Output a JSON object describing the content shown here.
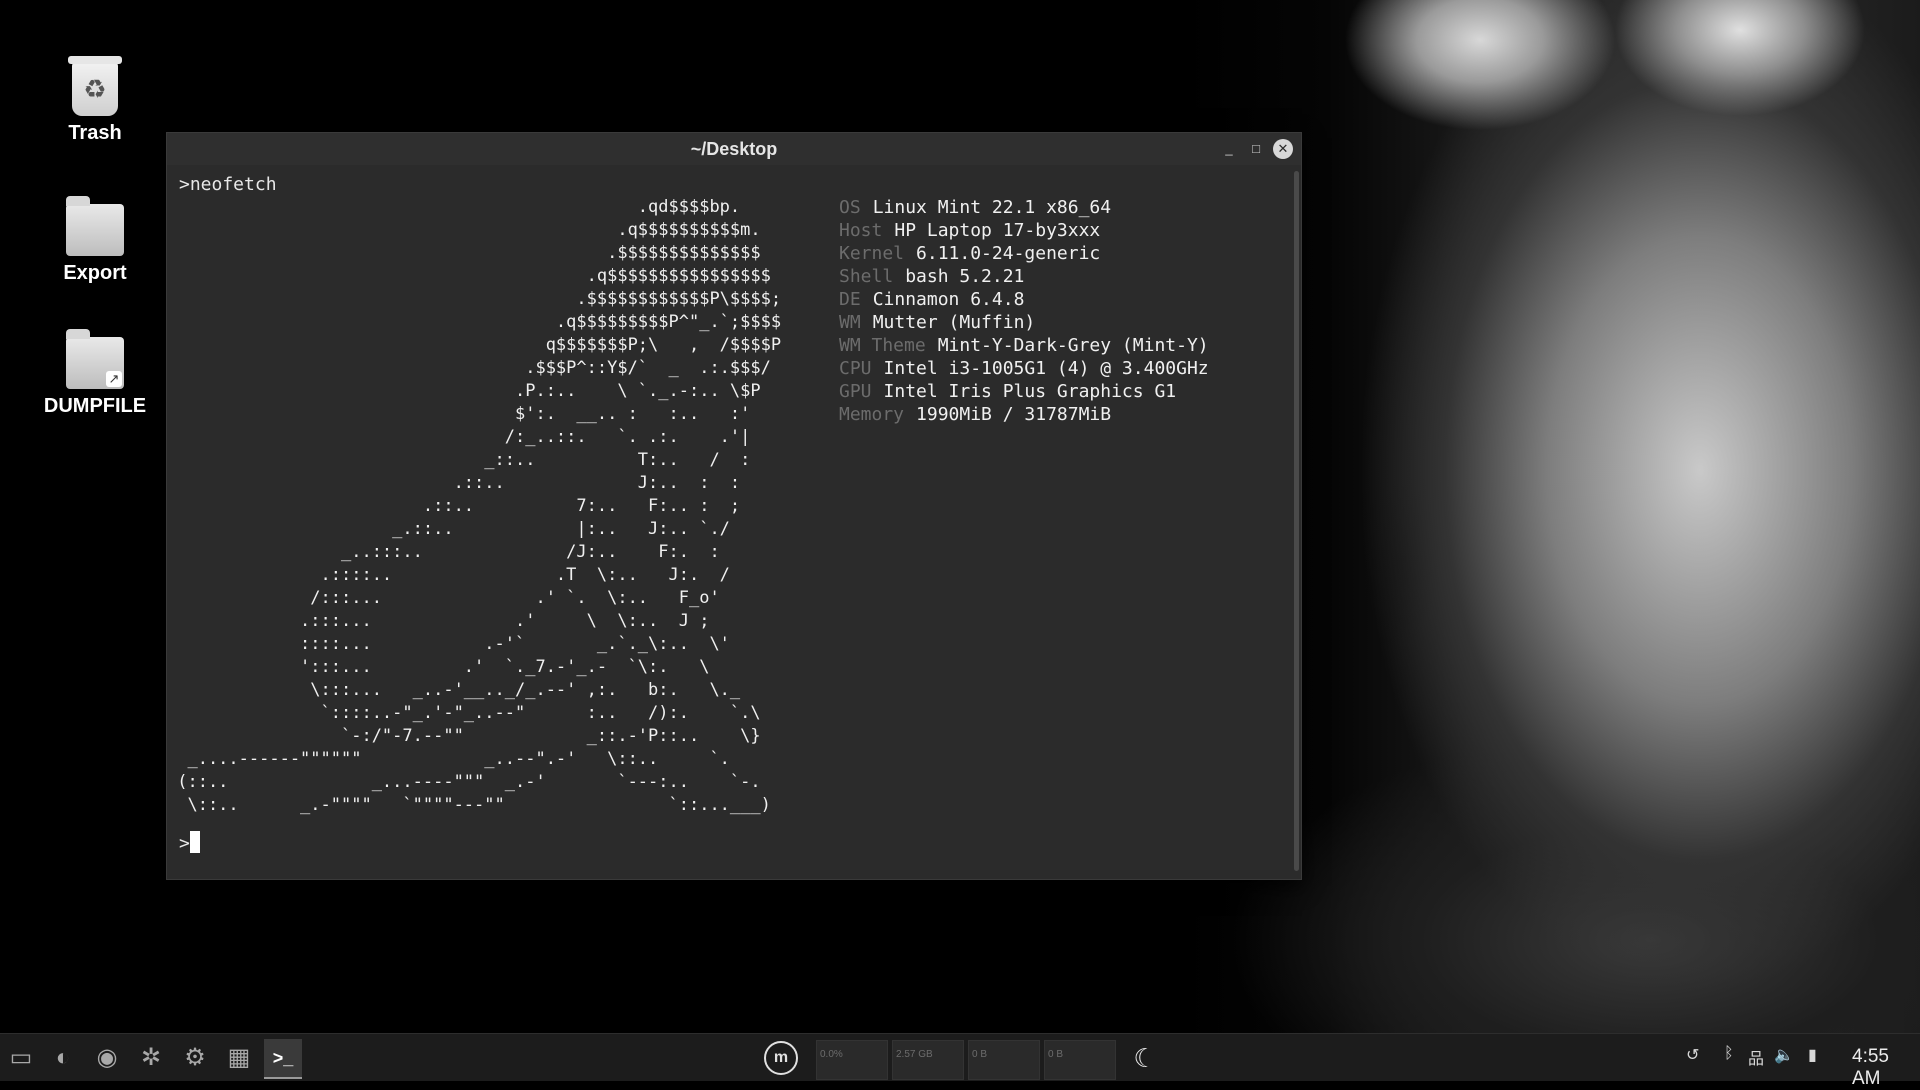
{
  "desktop": {
    "icons": [
      {
        "label": "Trash",
        "icon": "trash-icon"
      },
      {
        "label": "Export",
        "icon": "folder-icon"
      },
      {
        "label": "DUMPFILE",
        "icon": "folder-link-icon"
      }
    ]
  },
  "terminal": {
    "title": "~/Desktop",
    "controls": {
      "minimize": "_",
      "maximize": "□",
      "close": "✕"
    },
    "command": ">neofetch",
    "ascii_art": "                                              .qd$$$$bp.\n                                            .q$$$$$$$$$$m.\n                                           .$$$$$$$$$$$$$$\n                                         .q$$$$$$$$$$$$$$$$\n                                        .$$$$$$$$$$$$P\\$$$$;\n                                      .q$$$$$$$$$P^\"_.`;$$$$\n                                     q$$$$$$$P;\\   ,  /$$$$P\n                                   .$$$P^::Y$/`  _  .:.$$$/\n                                  .P.:..    \\ `._.-:.. \\$P\n                                  $':.  __.. :   :..   :'\n                                 /:_..::.   `. .:.    .'|\n                               _::..          T:..   /  :\n                            .::..             J:..  :  :\n                         .::..          7:..   F:.. :  ;\n                      _.::..            |:..   J:.. `./\n                 _..:::..              /J:..    F:.  :\n               .::::..                .T  \\:..   J:.  /\n              /:::...               .' `.  \\:..   F_o'\n             .:::...              .'     \\  \\:..  J ;\n             ::::...           .-'`       _.`._\\:..  \\'\n             ':::...         .'  `._7.-'_.-  `\\:.   \\\n              \\:::...   _..-'__.._/_.--' ,:.   b:.   \\._\n               `::::..-\"_.'-\"_..--\"      :..   /):.    `.\\\n                 `-:/\"-7.--\"\"            _::.-'P::..    \\}\n  _....------\"\"\"\"\"\"            _..--\".-'   \\::..     `.\n (::..              _...----\"\"\"  _.-'       `---:..    `-.\n  \\::..      _.-\"\"\"\"   `\"\"\"\"---\"\"                `::...___)",
    "info": [
      {
        "key": "OS",
        "value": "Linux Mint 22.1 x86_64"
      },
      {
        "key": "Host",
        "value": "HP Laptop 17-by3xxx"
      },
      {
        "key": "Kernel",
        "value": "6.11.0-24-generic"
      },
      {
        "key": "Shell",
        "value": "bash 5.2.21"
      },
      {
        "key": "DE",
        "value": "Cinnamon 6.4.8"
      },
      {
        "key": "WM",
        "value": "Mutter (Muffin)"
      },
      {
        "key": "WM Theme",
        "value": "Mint-Y-Dark-Grey (Mint-Y)"
      },
      {
        "key": "CPU",
        "value": "Intel i3-1005G1 (4) @ 3.400GHz"
      },
      {
        "key": "GPU",
        "value": "Intel Iris Plus Graphics G1"
      },
      {
        "key": "Memory",
        "value": "1990MiB / 31787MiB"
      }
    ],
    "prompt": ">"
  },
  "taskbar": {
    "apps": [
      {
        "name": "files",
        "icon": "folder-icon",
        "glyph": "▭"
      },
      {
        "name": "firefox",
        "icon": "firefox-icon",
        "glyph": "◐"
      },
      {
        "name": "github",
        "icon": "github-icon",
        "glyph": "◉"
      },
      {
        "name": "bug-tool",
        "icon": "bug-icon",
        "glyph": "✲"
      },
      {
        "name": "settings",
        "icon": "settings-icon",
        "glyph": "⚙"
      },
      {
        "name": "system-monitor",
        "icon": "monitor-app-icon",
        "glyph": "▦"
      },
      {
        "name": "terminal",
        "icon": "terminal-icon",
        "glyph": ">_"
      }
    ],
    "menu_icon": "mint-menu-icon",
    "menu_glyph": "m",
    "monitors": [
      {
        "name": "cpu",
        "value": "0.0%"
      },
      {
        "name": "memory",
        "value": "2.57 GB"
      },
      {
        "name": "network",
        "value": "0 B"
      },
      {
        "name": "disk",
        "value": "0 B"
      }
    ],
    "night_light_icon": "moon-icon",
    "night_light_glyph": "☾",
    "tray": [
      {
        "icon": "update-icon",
        "glyph": "↺"
      },
      {
        "icon": "bluetooth-icon",
        "glyph": "ᛒ"
      },
      {
        "icon": "network-icon",
        "glyph": "品"
      },
      {
        "icon": "volume-icon",
        "glyph": "🔈"
      },
      {
        "icon": "battery-icon",
        "glyph": "▮"
      }
    ],
    "clock": "4:55 AM"
  }
}
